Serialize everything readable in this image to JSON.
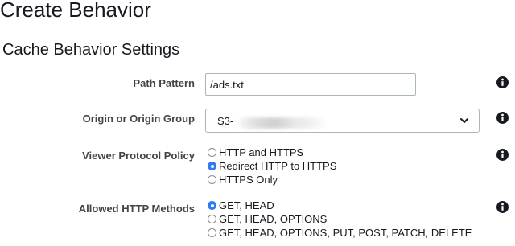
{
  "page": {
    "title": "Create Behavior"
  },
  "section": {
    "title": "Cache Behavior Settings"
  },
  "path_pattern": {
    "label": "Path Pattern",
    "value": "/ads.txt"
  },
  "origin": {
    "label": "Origin or Origin Group",
    "value": "S3-",
    "value_redacted": true
  },
  "viewer_protocol_policy": {
    "label": "Viewer Protocol Policy",
    "options": [
      {
        "label": "HTTP and HTTPS",
        "selected": false
      },
      {
        "label": "Redirect HTTP to HTTPS",
        "selected": true
      },
      {
        "label": "HTTPS Only",
        "selected": false
      }
    ]
  },
  "allowed_http_methods": {
    "label": "Allowed HTTP Methods",
    "options": [
      {
        "label": "GET, HEAD",
        "selected": true
      },
      {
        "label": "GET, HEAD, OPTIONS",
        "selected": false
      },
      {
        "label": "GET, HEAD, OPTIONS, PUT, POST, PATCH, DELETE",
        "selected": false
      }
    ]
  },
  "icons": {
    "info": "info-icon",
    "dropdown": "chevron-down-icon"
  },
  "colors": {
    "radio_selected": "#2f7af8",
    "label_text": "#444444",
    "body_text": "#16191f"
  }
}
